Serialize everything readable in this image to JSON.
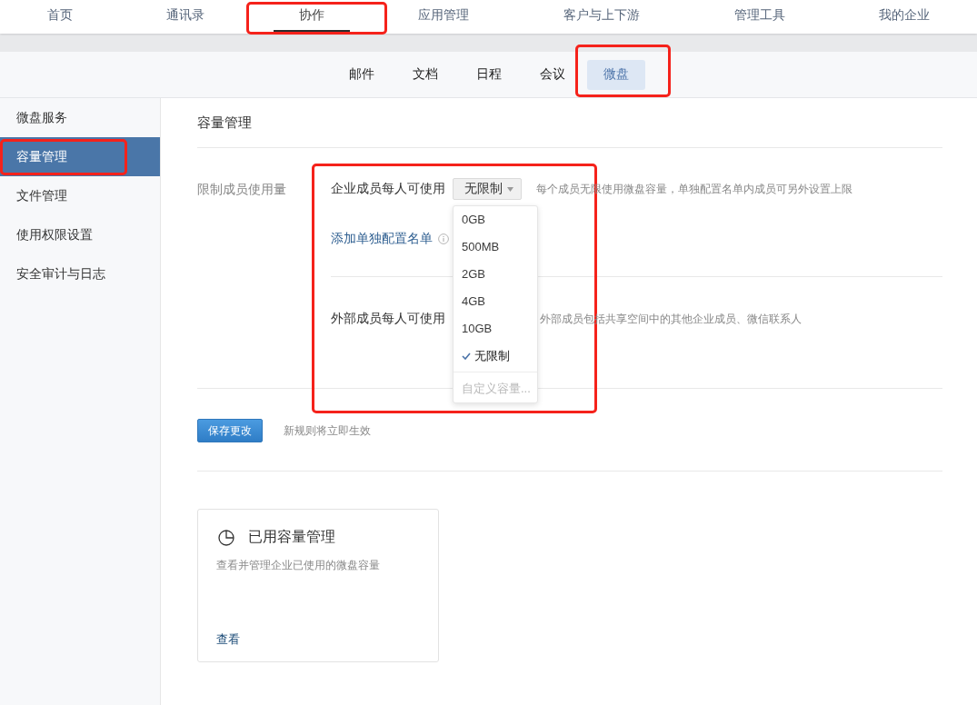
{
  "top_nav": [
    {
      "label": "首页",
      "selected": false,
      "highlighted": false
    },
    {
      "label": "通讯录",
      "selected": false,
      "highlighted": false
    },
    {
      "label": "协作",
      "selected": true,
      "highlighted": true
    },
    {
      "label": "应用管理",
      "selected": false,
      "highlighted": false
    },
    {
      "label": "客户与上下游",
      "selected": false,
      "highlighted": false
    },
    {
      "label": "管理工具",
      "selected": false,
      "highlighted": false
    },
    {
      "label": "我的企业",
      "selected": false,
      "highlighted": false
    }
  ],
  "sub_tabs": [
    {
      "label": "邮件",
      "selected": false,
      "highlighted": false
    },
    {
      "label": "文档",
      "selected": false,
      "highlighted": false
    },
    {
      "label": "日程",
      "selected": false,
      "highlighted": false
    },
    {
      "label": "会议",
      "selected": false,
      "highlighted": false
    },
    {
      "label": "微盘",
      "selected": true,
      "highlighted": true
    }
  ],
  "sidebar": {
    "items": [
      {
        "label": "微盘服务",
        "selected": false,
        "highlighted": false
      },
      {
        "label": "容量管理",
        "selected": true,
        "highlighted": true
      },
      {
        "label": "文件管理",
        "selected": false,
        "highlighted": false
      },
      {
        "label": "使用权限设置",
        "selected": false,
        "highlighted": false
      },
      {
        "label": "安全审计与日志",
        "selected": false,
        "highlighted": false
      }
    ]
  },
  "content": {
    "title": "容量管理",
    "quota": {
      "label": "限制成员使用量",
      "highlighted": true,
      "member_limit": {
        "label": "企业成员每人可使用",
        "value": "无限制",
        "expanded": true,
        "hint": "每个成员无限使用微盘容量，单独配置名单内成员可另外设置上限",
        "options": [
          {
            "label": "0GB",
            "selected": false
          },
          {
            "label": "500MB",
            "selected": false
          },
          {
            "label": "2GB",
            "selected": false
          },
          {
            "label": "4GB",
            "selected": false
          },
          {
            "label": "10GB",
            "selected": false
          },
          {
            "label": "无限制",
            "selected": true
          }
        ],
        "custom_option": {
          "label": "自定义容量...",
          "disabled": true
        }
      },
      "add_list_link": "添加单独配置名单",
      "external_limit": {
        "label": "外部成员每人可使用",
        "hint": "外部成员包括共享空间中的其他企业成员、微信联系人"
      }
    },
    "save": {
      "button": "保存更改",
      "note": "新规则将立即生效"
    },
    "card": {
      "title": "已用容量管理",
      "description": "查看并管理企业已使用的微盘容量",
      "link": "查看"
    }
  }
}
